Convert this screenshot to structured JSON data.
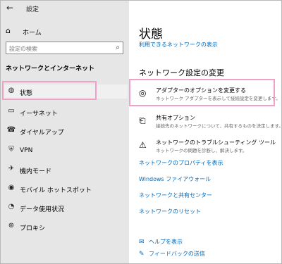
{
  "window": {
    "title": "設定",
    "back_icon": "back-arrow-icon"
  },
  "sidebar": {
    "home_label": "ホーム",
    "search_placeholder": "設定の検索",
    "section_title": "ネットワークとインターネット",
    "items": [
      {
        "label": "状態",
        "icon": "status-globe-icon"
      },
      {
        "label": "イーサネット",
        "icon": "ethernet-icon"
      },
      {
        "label": "ダイヤルアップ",
        "icon": "dialup-icon"
      },
      {
        "label": "VPN",
        "icon": "vpn-icon"
      },
      {
        "label": "機内モード",
        "icon": "airplane-icon"
      },
      {
        "label": "モバイル ホットスポット",
        "icon": "hotspot-icon"
      },
      {
        "label": "データ使用状況",
        "icon": "data-usage-icon"
      },
      {
        "label": "プロキシ",
        "icon": "proxy-globe-icon"
      }
    ]
  },
  "main": {
    "title": "状態",
    "available_networks_link": "利用できるネットワークの表示",
    "change_section_title": "ネットワーク設定の変更",
    "options": [
      {
        "title": "アダプターのオプションを変更する",
        "desc": "ネットワーク アダプターを表示して接続設定を変更します。",
        "icon": "adapter-icon"
      },
      {
        "title": "共有オプション",
        "desc": "接続先のネットワークについて、共有するものを決定します。",
        "icon": "sharing-icon"
      },
      {
        "title": "ネットワークのトラブルシューティング ツール",
        "desc": "ネットワークの問題を診断し、解決します。",
        "icon": "warning-icon"
      }
    ],
    "links": [
      "ネットワークのプロパティを表示",
      "Windows ファイアウォール",
      "ネットワークと共有センター",
      "ネットワークのリセット"
    ],
    "footer": {
      "help": "ヘルプを表示",
      "feedback": "フィードバックの送信"
    }
  },
  "colors": {
    "accent_link": "#0067b8",
    "highlight_border": "#f1a0c8",
    "sidebar_bg": "#e6e6e6"
  }
}
